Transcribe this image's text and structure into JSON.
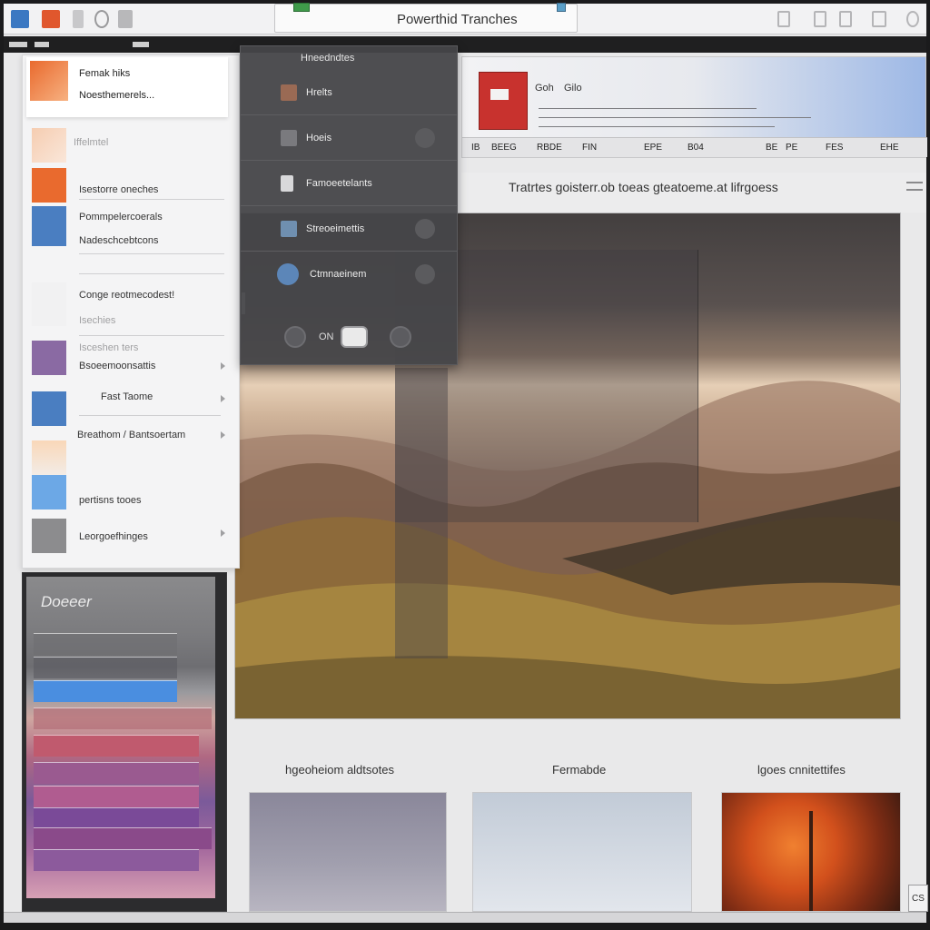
{
  "window": {
    "title": "Powerthid Tranches"
  },
  "left_menu": {
    "header_line1": "Femak hiks",
    "header_line2": "Noesthemerels...",
    "items": [
      {
        "label": "Iffelmtel",
        "faint": true
      },
      {
        "label": "Isestorre oneches"
      },
      {
        "label": "Pommpelercoerals"
      },
      {
        "label": "Nadeschcebtcons"
      },
      {
        "label": "Conge reotmecodest!"
      },
      {
        "label": "Isechies"
      },
      {
        "label": "Isceshen ters",
        "faint": true
      },
      {
        "label": "Bsoeemoonsattis"
      },
      {
        "label": "Fast Taome"
      },
      {
        "label": "Breathom / Bantsoertam"
      },
      {
        "label": "pertisns tooes"
      },
      {
        "label": "Leorgoefhinges"
      }
    ],
    "colors": {
      "orange": "#e96a2e",
      "blue": "#4a7ec1",
      "purple": "#8a6aa3",
      "light_blue": "#6ca8e6",
      "grey": "#8c8c8e"
    }
  },
  "swatch_panel": {
    "title": "Doeeer"
  },
  "dark_menu": {
    "header": "Hneedndtes",
    "items": [
      {
        "label": "Hrelts",
        "icon": "image-icon"
      },
      {
        "label": "Hoeis",
        "icon": "document-icon"
      },
      {
        "label": "Famoeetelants",
        "icon": "file-icon"
      },
      {
        "label": "Streoeimettis",
        "icon": "grid-icon"
      },
      {
        "label": "Ctmnaeinem",
        "icon": "user-icon"
      }
    ],
    "bottom_label": "ON"
  },
  "ribbon": {
    "label1": "Goh",
    "label2": "Gilo",
    "tabs": [
      "IB",
      "BEEG",
      "RBDE",
      "FIN",
      "EPE",
      "B04",
      "BE",
      "PE",
      "FES",
      "EHE"
    ]
  },
  "slide": {
    "heading": "Tratrtes goisterr.ob toeas gteatoeme.at lifrgoess"
  },
  "gallery": {
    "labels": [
      "hgeoheiom aldtsotes",
      "Fermabde",
      "lgoes cnnitettifes"
    ]
  },
  "footer": {
    "badge": "CS"
  }
}
